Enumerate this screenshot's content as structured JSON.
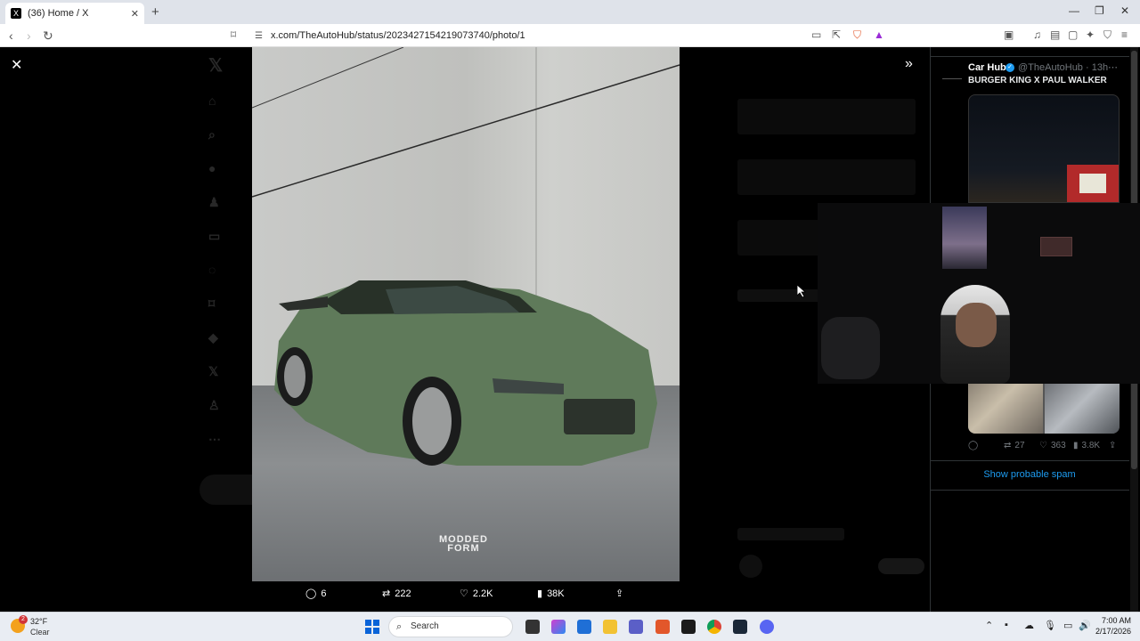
{
  "browser": {
    "tab_title": "(36) Home / X",
    "tab_favicon": "X",
    "url": "x.com/TheAutoHub/status/2023427154219073740/photo/1"
  },
  "viewer": {
    "close_icon": "close-icon",
    "expand_icon": "double-chevron-right-icon",
    "watermark_line1": "MODDED",
    "watermark_line2": "FORM",
    "actions": {
      "replies": "6",
      "reposts": "222",
      "likes": "2.2K",
      "views": "38K"
    }
  },
  "tweet_panel": {
    "name": "Car Hub",
    "handle": "@TheAutoHub",
    "time": "13h",
    "text": "BURGER KING X PAUL WALKER",
    "stats": {
      "replies": "",
      "reposts": "27",
      "likes": "363",
      "views": "3.8K"
    },
    "show_spam": "Show probable spam"
  },
  "taskbar": {
    "temp": "32°F",
    "condition": "Clear",
    "weather_badge": "2",
    "search_placeholder": "Search",
    "time": "7:00 AM",
    "date": "2/17/2026"
  },
  "colors": {
    "accent": "#1d9bf0",
    "background": "#000000",
    "muted": "#71767b"
  }
}
